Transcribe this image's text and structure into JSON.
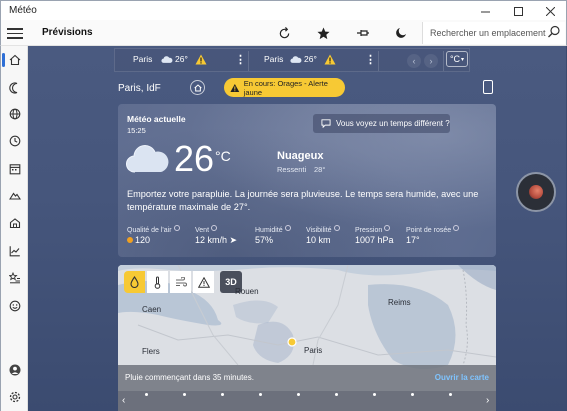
{
  "window": {
    "title": "Météo"
  },
  "header": {
    "page_title": "Prévisions",
    "search_placeholder": "Rechercher un emplacement"
  },
  "favorites": [
    {
      "city": "Paris",
      "temp": "26°"
    },
    {
      "city": "Paris",
      "temp": "26°"
    }
  ],
  "unit_button": "°C",
  "location": {
    "name": "Paris, IdF",
    "alert": "En cours: Orages - Alerte jaune"
  },
  "current": {
    "heading": "Météo actuelle",
    "time": "15:25",
    "feedback_button": "Vous voyez un temps différent ?",
    "temp": "26",
    "unit": "°C",
    "condition": "Nuageux",
    "feels_label": "Ressenti",
    "feels_value": "28°",
    "summary": "Emportez votre parapluie. La journée sera pluvieuse. Le temps sera humide, avec une température maximale de 27°.",
    "stats": [
      {
        "label": "Qualité de l'air",
        "value": "120"
      },
      {
        "label": "Vent",
        "value": "12 km/h"
      },
      {
        "label": "Humidité",
        "value": "57%"
      },
      {
        "label": "Visibilité",
        "value": "10 km"
      },
      {
        "label": "Pression",
        "value": "1007 hPa"
      },
      {
        "label": "Point de rosée",
        "value": "17°"
      }
    ]
  },
  "map": {
    "tool_3d": "3D",
    "cities": [
      "Rouen",
      "Caen",
      "Reims",
      "Flers",
      "Paris"
    ],
    "message": "Pluie commençant dans 35 minutes.",
    "open_link": "Ouvrir la carte"
  },
  "colors": {
    "accent": "#2e6fd6",
    "alert": "#f7c934",
    "link": "#7fc4ff",
    "aqi_dot": "#f0a020"
  }
}
